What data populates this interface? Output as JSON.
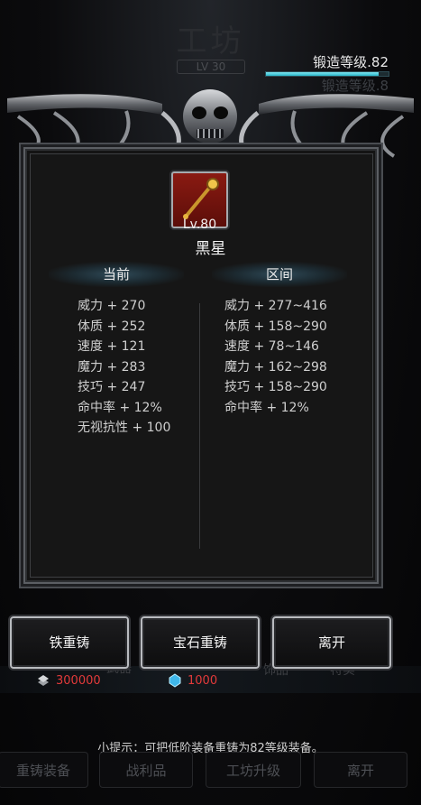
{
  "header": {
    "bg_title": "工坊",
    "bg_level": "LV 30",
    "forge_label": "锻造等级.82",
    "forge_ghost": "锻造等级.8",
    "forge_progress": 0.92,
    "accent": "#3fd0e0"
  },
  "item": {
    "level": "Lv.80",
    "name": "黑星",
    "icon": "golden-staff-icon"
  },
  "columns": {
    "current": "当前",
    "range": "区间"
  },
  "current_stats": [
    "威力 + 270",
    "体质 + 252",
    "速度 + 121",
    "魔力 + 283",
    "技巧 + 247",
    "命中率 + 12%",
    "无视抗性 + 100"
  ],
  "range_stats": [
    "威力 + 277~416",
    "体质 + 158~290",
    "速度 + 78~146",
    "魔力 + 162~298",
    "技巧 + 158~290",
    "命中率 + 12%"
  ],
  "actions": {
    "iron_recast": "铁重铸",
    "gem_recast": "宝石重铸",
    "leave": "离开"
  },
  "costs": {
    "iron_amount": "300000",
    "iron_color": "#e33a3a",
    "gem_amount": "1000",
    "gem_color": "#e33a3a"
  },
  "ghost_tabs": {
    "weapons": "武器",
    "accessories": "饰品",
    "other": "特实"
  },
  "hint": "小提示：可把低阶装备重铸为82等级装备。",
  "tabs": [
    "重铸装备",
    "战利品",
    "工坊升级",
    "离开"
  ]
}
